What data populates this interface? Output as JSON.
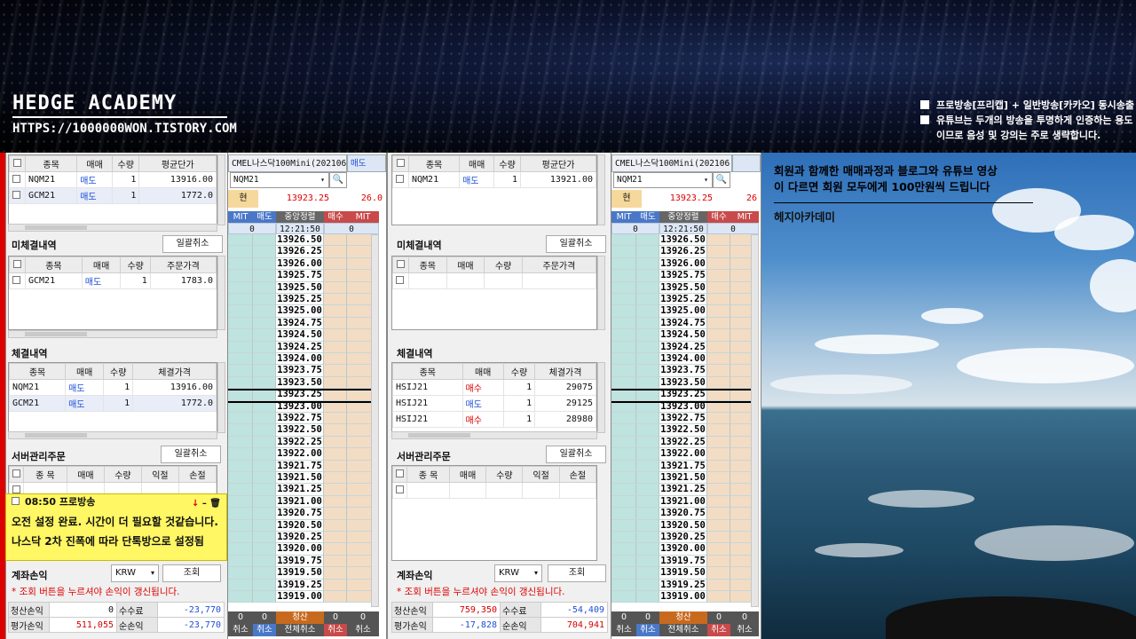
{
  "header": {
    "brand": "HEDGE ACADEMY",
    "url": "HTTPS://1000000WON.TISTORY.COM",
    "notices": [
      "프로방송[프리캡] + 일반방송[카카오] 동시송출",
      "유튜브는 두개의 방송을 투명하게 인증하는 용도",
      "이므로 음성 및 강의는 주로 생략합니다."
    ]
  },
  "left": {
    "positions": {
      "headers": [
        "종목",
        "매매",
        "수량",
        "평균단가"
      ],
      "rows": [
        {
          "sym": "NQM21",
          "side": "매도",
          "qty": "1",
          "price": "13916.00"
        },
        {
          "sym": "GCM21",
          "side": "매도",
          "qty": "1",
          "price": "1772.0"
        }
      ]
    },
    "unfilled": {
      "title": "미체결내역",
      "cancel_all": "일괄취소",
      "headers": [
        "종목",
        "매매",
        "수량",
        "주문가격"
      ],
      "rows": [
        {
          "sym": "GCM21",
          "side": "매도",
          "qty": "1",
          "price": "1783.0"
        }
      ]
    },
    "filled": {
      "title": "체결내역",
      "headers": [
        "종목",
        "매매",
        "수량",
        "체결가격"
      ],
      "rows": [
        {
          "sym": "NQM21",
          "side": "매도",
          "qty": "1",
          "price": "13916.00"
        },
        {
          "sym": "GCM21",
          "side": "매도",
          "qty": "1",
          "price": "1772.0"
        }
      ]
    },
    "server": {
      "title": "서버관리주문",
      "cancel_all": "일괄취소",
      "headers": [
        "종 목",
        "매매",
        "수량",
        "익절",
        "손절"
      ]
    },
    "note": {
      "time": "08:50 프로방송",
      "lines": [
        "오전 설정 완료. 시간이 더 필요할 것같습니다.",
        "나스닥 2차 진폭에 따라 단톡방으로 설정됨"
      ]
    },
    "account": {
      "title": "계좌손익",
      "currency": "KRW",
      "query": "조회",
      "warn": "* 조회 버튼을 누르셔야 손익이 갱신됩니다.",
      "labels": [
        "청산손익",
        "수수료",
        "평가손익",
        "순손익"
      ],
      "values": [
        "0",
        "-23,770",
        "511,055",
        "-23,770"
      ]
    }
  },
  "ladder1": {
    "instrument": "CMEL나스닥100Mini(202106",
    "side": "매도",
    "symbol": "NQM21",
    "cur_label": "현",
    "cur_price": "13923.25",
    "change": "26.0",
    "col_headers": [
      "MIT",
      "매도",
      "중앙정렬",
      "매수",
      "MIT"
    ],
    "counts": [
      "0",
      "12:21:50",
      "0"
    ],
    "footer_counts": [
      "0",
      "0",
      "청산",
      "0",
      "0"
    ],
    "footer": [
      "취소",
      "취소",
      "전체취소",
      "취소",
      "취소"
    ]
  },
  "mid": {
    "positions": {
      "headers": [
        "종목",
        "매매",
        "수량",
        "평균단가"
      ],
      "rows": [
        {
          "sym": "NQM21",
          "side": "매도",
          "qty": "1",
          "price": "13921.00"
        }
      ]
    },
    "unfilled": {
      "title": "미체결내역",
      "cancel_all": "일괄취소",
      "headers": [
        "종목",
        "매매",
        "수량",
        "주문가격"
      ]
    },
    "filled": {
      "title": "체결내역",
      "headers": [
        "종목",
        "매매",
        "수량",
        "체결가격"
      ],
      "rows": [
        {
          "sym": "HSIJ21",
          "side": "매수",
          "qty": "1",
          "price": "29075"
        },
        {
          "sym": "HSIJ21",
          "side": "매도",
          "qty": "1",
          "price": "29125"
        },
        {
          "sym": "HSIJ21",
          "side": "매수",
          "qty": "1",
          "price": "28980"
        }
      ]
    },
    "server": {
      "title": "서버관리주문",
      "cancel_all": "일괄취소",
      "headers": [
        "종 목",
        "매매",
        "수량",
        "익절",
        "손절"
      ]
    },
    "account": {
      "title": "계좌손익",
      "currency": "KRW",
      "query": "조회",
      "warn": "* 조회 버튼을 누르셔야 손익이 갱신됩니다.",
      "labels": [
        "청산손익",
        "수수료",
        "평가손익",
        "순손익"
      ],
      "values": [
        "759,350",
        "-54,409",
        "-17,828",
        "704,941"
      ]
    }
  },
  "ladder2": {
    "instrument": "CMEL나스닥100Mini(202106",
    "symbol": "NQM21",
    "cur_label": "현",
    "cur_price": "13923.25",
    "change": "26",
    "col_headers": [
      "MIT",
      "매도",
      "중앙정렬",
      "매수",
      "MIT"
    ],
    "counts": [
      "0",
      "12:21:50",
      "0"
    ],
    "footer_counts": [
      "0",
      "0",
      "청산",
      "0",
      "0"
    ],
    "footer": [
      "취소",
      "취소",
      "전체취소",
      "취소",
      "취소"
    ]
  },
  "prices": [
    "13926.50",
    "13926.25",
    "13926.00",
    "13925.75",
    "13925.50",
    "13925.25",
    "13925.00",
    "13924.75",
    "13924.50",
    "13924.25",
    "13924.00",
    "13923.75",
    "13923.50",
    "13923.25",
    "13923.00",
    "13922.75",
    "13922.50",
    "13922.25",
    "13922.00",
    "13921.75",
    "13921.50",
    "13921.25",
    "13921.00",
    "13920.75",
    "13920.50",
    "13920.25",
    "13920.00",
    "13919.75",
    "13919.50",
    "13919.25",
    "13919.00"
  ],
  "promo": {
    "lines": [
      "회원과 함께한 매매과정과 블로그와 유튜브 영상",
      "이 다르면 회원 모두에게 100만원씩 드립니다"
    ],
    "sub": "헤지아카데미"
  }
}
